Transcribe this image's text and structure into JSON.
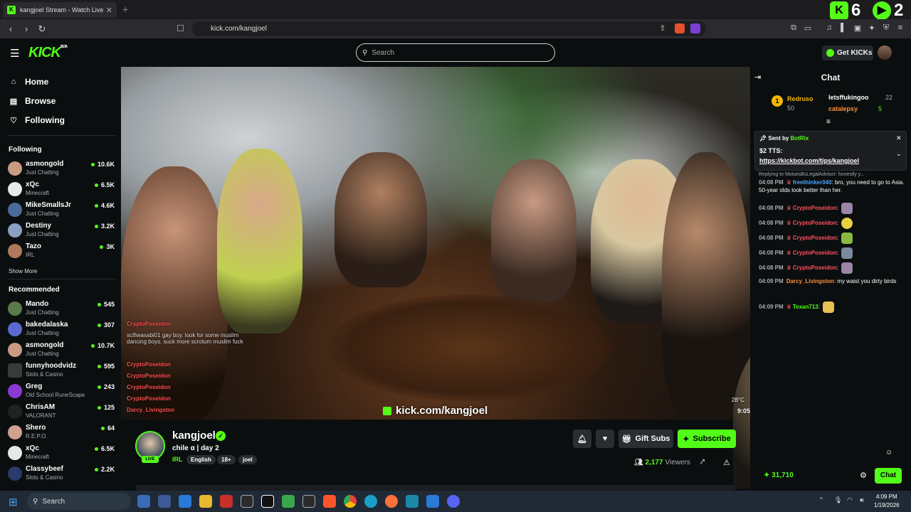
{
  "browser": {
    "tab_title": "kangjoel Stream - Watch Live",
    "url": "kick.com/kangjoel",
    "overlay_counts": [
      "6",
      "2"
    ]
  },
  "header": {
    "logo": "KICK",
    "logo_beta": "BETA",
    "search_placeholder": "Search",
    "get_kicks": "Get KICKs"
  },
  "sidebar": {
    "nav": [
      {
        "label": "Home",
        "icon": "home-icon"
      },
      {
        "label": "Browse",
        "icon": "browse-icon"
      },
      {
        "label": "Following",
        "icon": "heart-icon"
      }
    ],
    "following_title": "Following",
    "following": [
      {
        "name": "asmongold",
        "category": "Just Chatting",
        "viewers": "10.6K"
      },
      {
        "name": "xQc",
        "category": "Minecraft",
        "viewers": "6.5K"
      },
      {
        "name": "MikeSmallsJr",
        "category": "Just Chatting",
        "viewers": "4.6K"
      },
      {
        "name": "Destiny",
        "category": "Just Chatting",
        "viewers": "3.2K"
      },
      {
        "name": "Tazo",
        "category": "IRL",
        "viewers": "3K"
      }
    ],
    "show_more": "Show More",
    "recommended_title": "Recommended",
    "recommended": [
      {
        "name": "Mando",
        "category": "Just Chatting",
        "viewers": "545"
      },
      {
        "name": "bakedalaska",
        "category": "Just Chatting",
        "viewers": "307"
      },
      {
        "name": "asmongold",
        "category": "Just Chatting",
        "viewers": "10.7K"
      },
      {
        "name": "funnyhoodvidz",
        "category": "Slots & Casino",
        "viewers": "595"
      },
      {
        "name": "Greg",
        "category": "Old School RuneScape",
        "viewers": "243"
      },
      {
        "name": "ChrisAM",
        "category": "VALORANT",
        "viewers": "125"
      },
      {
        "name": "Shero",
        "category": "R.E.P.O.",
        "viewers": "64"
      },
      {
        "name": "xQc",
        "category": "Minecraft",
        "viewers": "6.5K"
      },
      {
        "name": "Classybeef",
        "category": "Slots & Casino",
        "viewers": "2.2K"
      }
    ]
  },
  "video": {
    "watermark": "kick.com/kangjoel",
    "overlay_chat": [
      {
        "user": "CryptoPoseidon",
        "text": ""
      },
      {
        "user": "scifiwasabi01",
        "text": "gay boy. look for some muslim dancing boys. suck more scrotum muslim fuck"
      },
      {
        "user": "CryptoPoseidon",
        "text": ""
      },
      {
        "user": "CryptoPoseidon",
        "text": ""
      },
      {
        "user": "CryptoPoseidon",
        "text": ""
      },
      {
        "user": "CryptoPoseidon",
        "text": ""
      },
      {
        "user": "Darcy_Livingston",
        "text": ""
      }
    ],
    "temp": "28°C",
    "time": "9:05"
  },
  "stream": {
    "name": "kangjoel",
    "live_label": "LIVE",
    "title": "chile α | day 2",
    "category": "IRL",
    "tags": [
      "English",
      "18+",
      "joel"
    ],
    "gift_subs": "Gift Subs",
    "subscribe": "Subscribe",
    "viewers": "2,177",
    "viewers_label": "Viewers"
  },
  "chat": {
    "title": "Chat",
    "leaderboard": [
      {
        "rank": "1",
        "name": "Redruso",
        "value": "50"
      },
      {
        "name": "letsffukingoo",
        "value": "22"
      },
      {
        "name": "catalepsy",
        "value": "5"
      }
    ],
    "pinned": {
      "sent_by_label": "Sent by",
      "sender": "BotRix",
      "line1": "$2 TTS:",
      "line2": "https://kickbot.com/tips/kangjoel"
    },
    "reply_hint": "Replying to MoisesBsLegalAdvisor: honestly y...",
    "messages": [
      {
        "time": "04:08 PM",
        "user": "freethinker040",
        "color": "blue",
        "text": ": bro, you need to go to Asia. 50-year olds look better than her."
      },
      {
        "time": "04:08 PM",
        "user": "CryptoPoseidon",
        "color": "red",
        "text": ":"
      },
      {
        "time": "04:08 PM",
        "user": "CryptoPoseidon",
        "color": "red",
        "text": ":"
      },
      {
        "time": "04:08 PM",
        "user": "CryptoPoseidon",
        "color": "red",
        "text": ":"
      },
      {
        "time": "04:08 PM",
        "user": "CryptoPoseidon",
        "color": "red",
        "text": ":"
      },
      {
        "time": "04:08 PM",
        "user": "CryptoPoseidon",
        "color": "red",
        "text": ":"
      },
      {
        "time": "04:09 PM",
        "user": "Darcy_Livingston",
        "color": "orange",
        "text": ": my waist you dirty birds"
      },
      {
        "time": "04:09 PM",
        "user": "Texan713",
        "color": "green",
        "text": ":"
      }
    ],
    "points": "31,710",
    "send_button": "Chat"
  },
  "taskbar": {
    "search": "Search",
    "time": "4:09 PM",
    "date": "1/19/2026"
  },
  "colors": {
    "kick_green": "#53fc18",
    "bg": "#0b0e0f",
    "chat_red": "#ff4f5e"
  }
}
